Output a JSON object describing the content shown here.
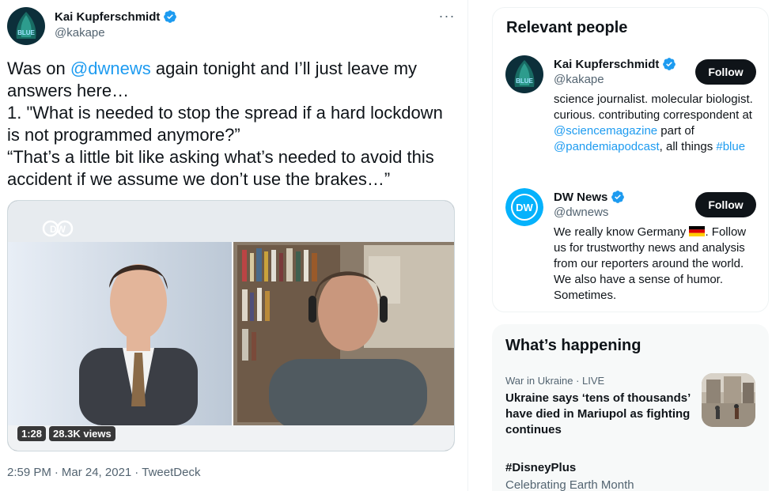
{
  "tweet": {
    "author_name": "Kai Kupferschmidt",
    "author_handle": "@kakape",
    "avatar_text": "BLUE",
    "more_label": "···",
    "text_line1_pre": "Was on ",
    "text_line1_mention": "@dwnews",
    "text_line1_post": " again tonight and I’ll just leave my answers here…",
    "text_line2": "1. \"What is needed to stop the spread if a hard lockdown is not programmed anymore?”",
    "text_line3": "“That’s a little bit like asking what’s needed to avoid this accident if we assume we don’t use the brakes…”",
    "video_logo": "DW",
    "video_duration": "1:28",
    "video_views": "28.3K views",
    "time": "2:59 PM",
    "date": "Mar 24, 2021",
    "source": "TweetDeck",
    "separator": "·"
  },
  "relevant_people": {
    "title": "Relevant people",
    "people": [
      {
        "name": "Kai Kupferschmidt",
        "handle": "@kakape",
        "follow_label": "Follow",
        "bio_1": "science journalist. molecular biologist. curious. contributing correspondent at ",
        "bio_mention_1": "@sciencemagazine",
        "bio_2": " part of ",
        "bio_mention_2": "@pandemiapodcast",
        "bio_3": ", all things ",
        "bio_hashtag": "#blue"
      },
      {
        "name": "DW News",
        "handle": "@dwnews",
        "follow_label": "Follow",
        "avatar_text": "DW",
        "bio_1": "We really know Germany ",
        "bio_2": ". Follow us for trustworthy news and analysis from our reporters around the world. We also have a sense of humor. Sometimes."
      }
    ]
  },
  "happening": {
    "title": "What’s happening",
    "trends": [
      {
        "meta": "War in Ukraine · LIVE",
        "title": "Ukraine says ‘tens of thousands’ have died in Mariupol as fighting continues"
      },
      {
        "title": "#DisneyPlus",
        "subtitle": "Celebrating Earth Month"
      }
    ]
  },
  "colors": {
    "accent": "#1d9bf0",
    "text": "#0f1419",
    "muted": "#536471",
    "follow_bg": "#0f1419",
    "dw_blue": "#05b2fc"
  },
  "icons": [
    "verified-badge-icon",
    "more-options-icon",
    "dw-logo-icon",
    "german-flag-icon"
  ]
}
